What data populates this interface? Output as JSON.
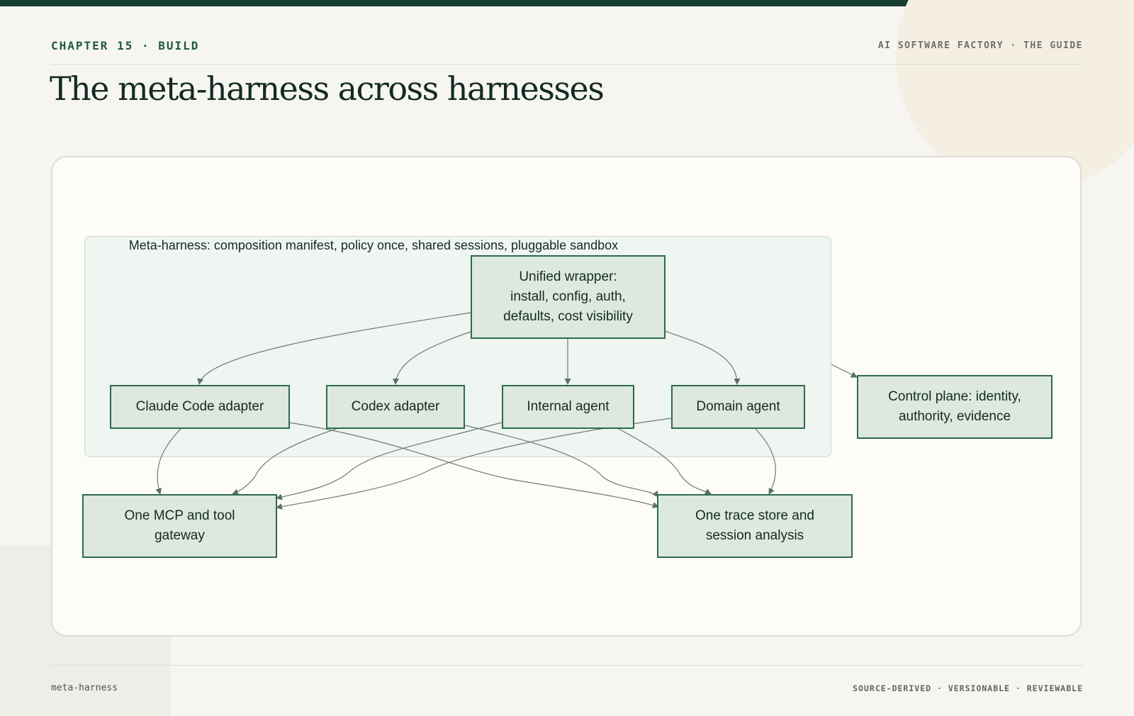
{
  "header": {
    "chapter": "CHAPTER 15 · BUILD",
    "guide": "AI SOFTWARE FACTORY · THE GUIDE",
    "title": "The meta-harness across harnesses"
  },
  "diagram": {
    "group_label": "Meta-harness: composition manifest, policy once, shared sessions, pluggable sandbox",
    "nodes": {
      "wrapper": [
        "Unified wrapper:",
        "install, config, auth,",
        "defaults, cost visibility"
      ],
      "claude": "Claude Code adapter",
      "codex": "Codex adapter",
      "internal": "Internal agent",
      "domain": "Domain agent",
      "control": [
        "Control plane: identity,",
        "authority, evidence"
      ],
      "gateway": [
        "One MCP and tool",
        "gateway"
      ],
      "trace": [
        "One trace store and",
        "session analysis"
      ]
    },
    "edges": [
      [
        "wrapper",
        "claude"
      ],
      [
        "wrapper",
        "codex"
      ],
      [
        "wrapper",
        "internal"
      ],
      [
        "wrapper",
        "domain"
      ],
      [
        "meta-harness",
        "control"
      ],
      [
        "claude",
        "gateway"
      ],
      [
        "claude",
        "trace"
      ],
      [
        "codex",
        "gateway"
      ],
      [
        "codex",
        "trace"
      ],
      [
        "internal",
        "gateway"
      ],
      [
        "internal",
        "trace"
      ],
      [
        "domain",
        "gateway"
      ],
      [
        "domain",
        "trace"
      ]
    ]
  },
  "footer": {
    "left": "meta-harness",
    "right": "SOURCE-DERIVED · VERSIONABLE · REVIEWABLE"
  }
}
